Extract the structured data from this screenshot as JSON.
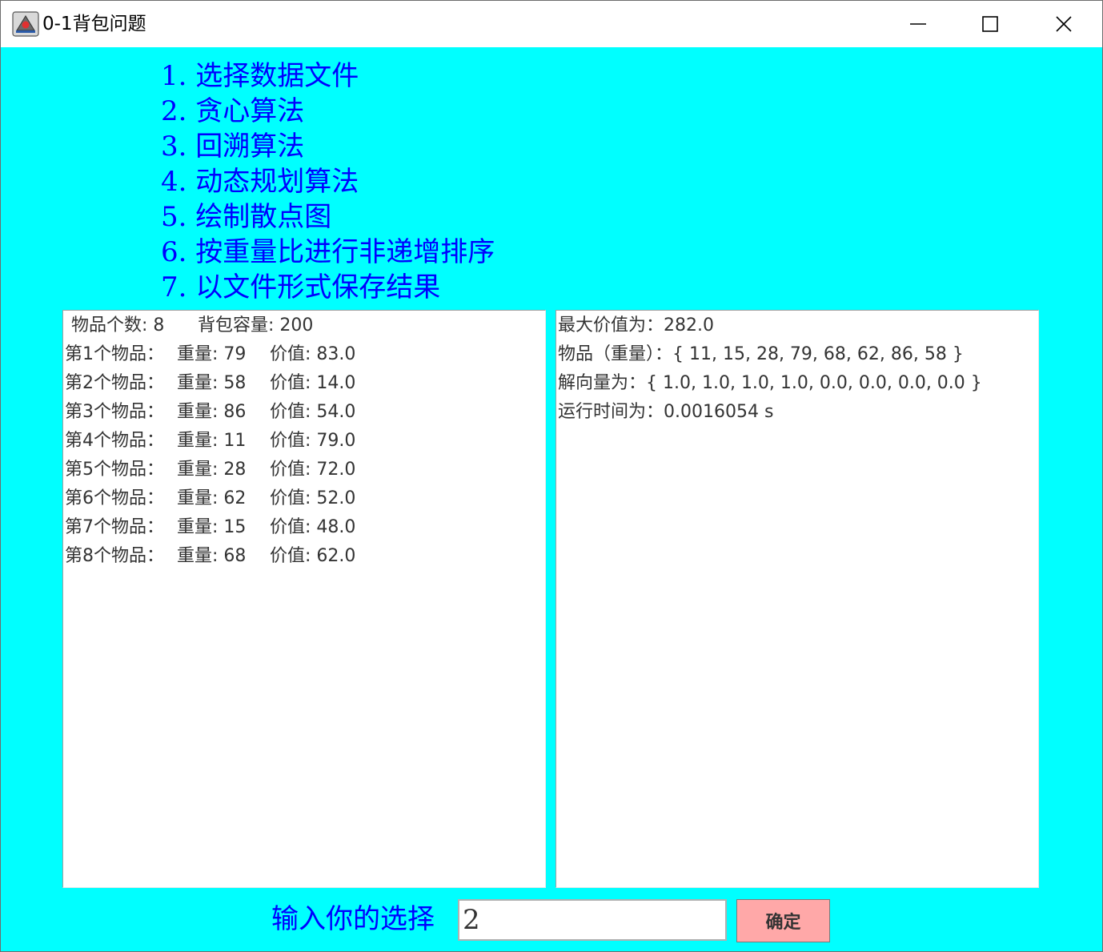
{
  "window": {
    "title": "0-1背包问题"
  },
  "menu": [
    "1. 选择数据文件",
    "2. 贪心算法",
    "3. 回溯算法",
    "4. 动态规划算法",
    "5. 绘制散点图",
    "6. 按重量比进行非递增排序",
    "7. 以文件形式保存结果"
  ],
  "left_panel": {
    "header": {
      "count_label": "物品个数: 8",
      "capacity_label": "背包容量: 200"
    },
    "items": [
      {
        "name": "第1个物品：",
        "weight": "重量: 79",
        "value": "价值: 83.0"
      },
      {
        "name": "第2个物品：",
        "weight": "重量: 58",
        "value": "价值: 14.0"
      },
      {
        "name": "第3个物品：",
        "weight": "重量: 86",
        "value": "价值: 54.0"
      },
      {
        "name": "第4个物品：",
        "weight": "重量: 11",
        "value": "价值: 79.0"
      },
      {
        "name": "第5个物品：",
        "weight": "重量: 28",
        "value": "价值: 72.0"
      },
      {
        "name": "第6个物品：",
        "weight": "重量: 62",
        "value": "价值: 52.0"
      },
      {
        "name": "第7个物品：",
        "weight": "重量: 15",
        "value": "价值: 48.0"
      },
      {
        "name": "第8个物品：",
        "weight": "重量: 68",
        "value": "价值: 62.0"
      }
    ]
  },
  "right_panel": {
    "lines": [
      "最大价值为：282.0",
      "物品（重量）：{ 11, 15, 28, 79, 68, 62, 86, 58 }",
      "解向量为：{ 1.0, 1.0, 1.0, 1.0, 0.0, 0.0, 0.0, 0.0 }",
      "运行时间为：0.0016054 s"
    ]
  },
  "input": {
    "label": "输入你的选择",
    "value": "2",
    "button_label": "确定"
  },
  "colors": {
    "background": "#00ffff",
    "menu_text": "#0000ff",
    "button": "#ffa8a8"
  }
}
